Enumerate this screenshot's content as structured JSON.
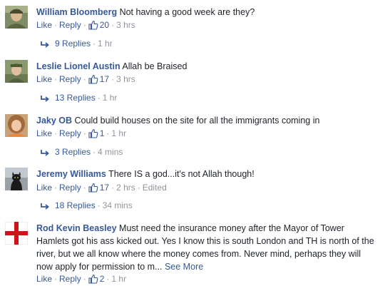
{
  "comments": [
    {
      "author": "William Bloomberg",
      "text": "Not having a good week are they?",
      "like_label": "Like",
      "reply_label": "Reply",
      "likes": "20",
      "time": "3 hrs",
      "edited": "",
      "replies_label": "9 Replies",
      "replies_time": "1 hr"
    },
    {
      "author": "Leslie Lionel Austin",
      "text": "Allah be Braised",
      "like_label": "Like",
      "reply_label": "Reply",
      "likes": "17",
      "time": "3 hrs",
      "edited": "",
      "replies_label": "13 Replies",
      "replies_time": "1 hr"
    },
    {
      "author": "Jaky OB",
      "text": "Could build houses on the site for all the immigrants coming in",
      "like_label": "Like",
      "reply_label": "Reply",
      "likes": "1",
      "time": "1 hr",
      "edited": "",
      "replies_label": "3 Replies",
      "replies_time": "4 mins"
    },
    {
      "author": "Jeremy Williams",
      "text": "There IS a god...it's not Allah though!",
      "like_label": "Like",
      "reply_label": "Reply",
      "likes": "17",
      "time": "2 hrs",
      "edited": "Edited",
      "replies_label": "18 Replies",
      "replies_time": "34 mins"
    },
    {
      "author": "Rod Kevin Beasley",
      "text": "Must need the insurance money after the Mayor of Tower Hamlets got his ass kicked out. Yes I know this is south London and TH is north of the river, but we all know where the money comes from. Never mind, perhaps they will now apply for permission to m...",
      "see_more": "See More",
      "like_label": "Like",
      "reply_label": "Reply",
      "likes": "2",
      "time": "1 hr",
      "edited": ""
    }
  ],
  "colors": {
    "link": "#365899",
    "meta": "#90949c",
    "text": "#1d2129"
  },
  "icons": {
    "like": "thumbs-up-icon",
    "reply": "reply-arrow-icon"
  }
}
